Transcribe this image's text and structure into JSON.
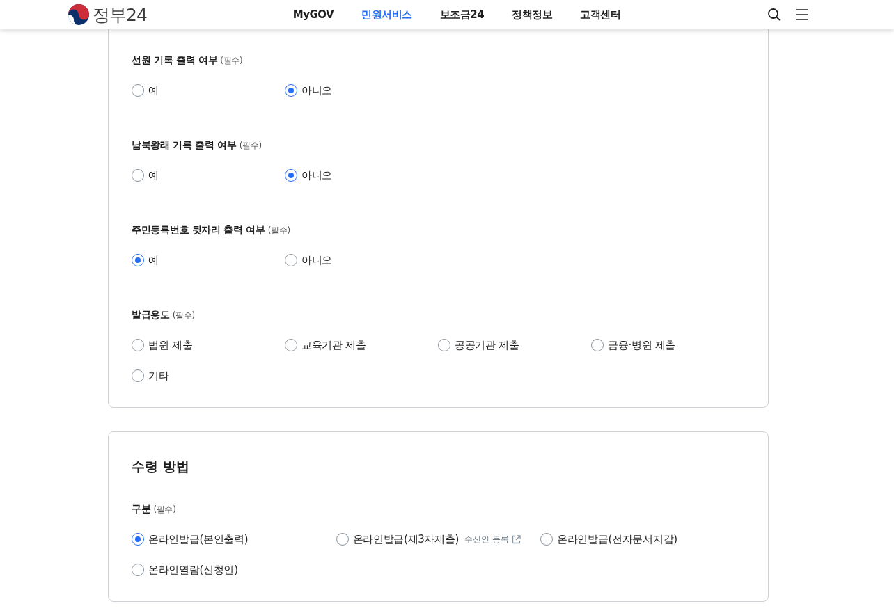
{
  "header": {
    "logo_text": "정부24",
    "nav": [
      {
        "label": "MyGOV",
        "selected": false
      },
      {
        "label": "민원서비스",
        "selected": true
      },
      {
        "label": "보조금24",
        "selected": false
      },
      {
        "label": "정책정보",
        "selected": false
      },
      {
        "label": "고객센터",
        "selected": false
      }
    ]
  },
  "cards": [
    {
      "groups": [
        {
          "label": "선원 기록 출력 여부",
          "required": "(필수)",
          "options": [
            {
              "label": "예",
              "selected": false
            },
            {
              "label": "아니오",
              "selected": true
            }
          ]
        },
        {
          "label": "남북왕래 기록 출력 여부",
          "required": "(필수)",
          "options": [
            {
              "label": "예",
              "selected": false
            },
            {
              "label": "아니오",
              "selected": true
            }
          ]
        },
        {
          "label": "주민등록번호 뒷자리 출력 여부",
          "required": "(필수)",
          "options": [
            {
              "label": "예",
              "selected": true
            },
            {
              "label": "아니오",
              "selected": false
            }
          ]
        },
        {
          "label": "발급용도",
          "required": "(필수)",
          "options": [
            {
              "label": "법원 제출",
              "selected": false
            },
            {
              "label": "교육기관 제출",
              "selected": false
            },
            {
              "label": "공공기관 제출",
              "selected": false
            },
            {
              "label": "금융·병원 제출",
              "selected": false
            },
            {
              "label": "기타",
              "selected": false
            }
          ]
        }
      ]
    },
    {
      "title": "수령 방법",
      "groups": [
        {
          "label": "구분",
          "required": "(필수)",
          "options": [
            {
              "label": "온라인발급(본인출력)",
              "selected": true
            },
            {
              "label": "온라인발급(제3자제출)",
              "selected": false,
              "link": "수신인 등록"
            },
            {
              "label": "온라인발급(전자문서지갑)",
              "selected": false
            },
            {
              "label": "온라인열람(신청인)",
              "selected": false
            }
          ]
        }
      ]
    }
  ]
}
